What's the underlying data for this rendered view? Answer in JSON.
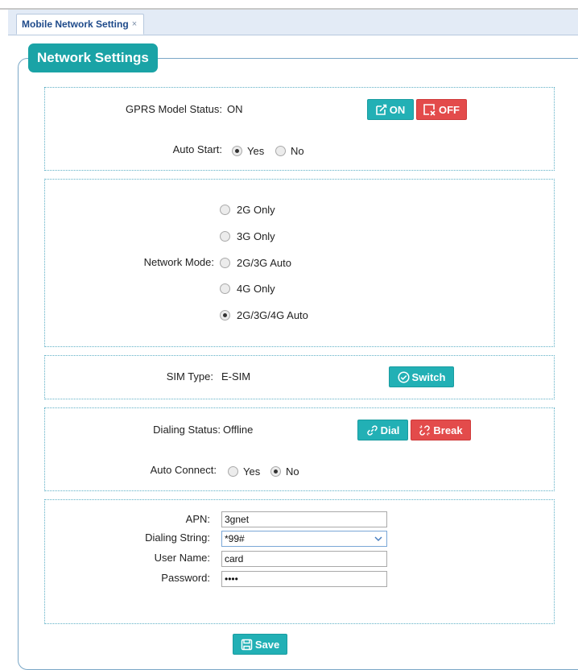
{
  "tab": {
    "label": "Mobile Network Setting",
    "close": "×"
  },
  "legend": "Network Settings",
  "gprs": {
    "status_label": "GPRS Model Status:",
    "status_value": "ON",
    "on_button": "ON",
    "off_button": "OFF",
    "autostart_label": "Auto Start:",
    "autostart_options": [
      "Yes",
      "No"
    ],
    "autostart_selected": "Yes"
  },
  "network_mode": {
    "label": "Network Mode:",
    "options": [
      "2G Only",
      "3G Only",
      "2G/3G Auto",
      "4G Only",
      "2G/3G/4G Auto"
    ],
    "selected": "2G/3G/4G Auto"
  },
  "sim": {
    "label": "SIM Type:",
    "value": "E-SIM",
    "switch_button": "Switch"
  },
  "dialing": {
    "status_label": "Dialing Status:",
    "status_value": "Offline",
    "dial_button": "Dial",
    "break_button": "Break",
    "autoconnect_label": "Auto Connect:",
    "autoconnect_options": [
      "Yes",
      "No"
    ],
    "autoconnect_selected": "No"
  },
  "apn": {
    "apn_label": "APN:",
    "apn_value": "3gnet",
    "dialing_string_label": "Dialing String:",
    "dialing_string_value": "*99#",
    "username_label": "User Name:",
    "username_value": "card",
    "password_label": "Password:",
    "password_value": "••••"
  },
  "save_button": "Save",
  "colors": {
    "teal": "#22b0b5",
    "red": "#e34b4b",
    "legend": "#1aa3a6",
    "tab_text": "#1e4a8a"
  }
}
